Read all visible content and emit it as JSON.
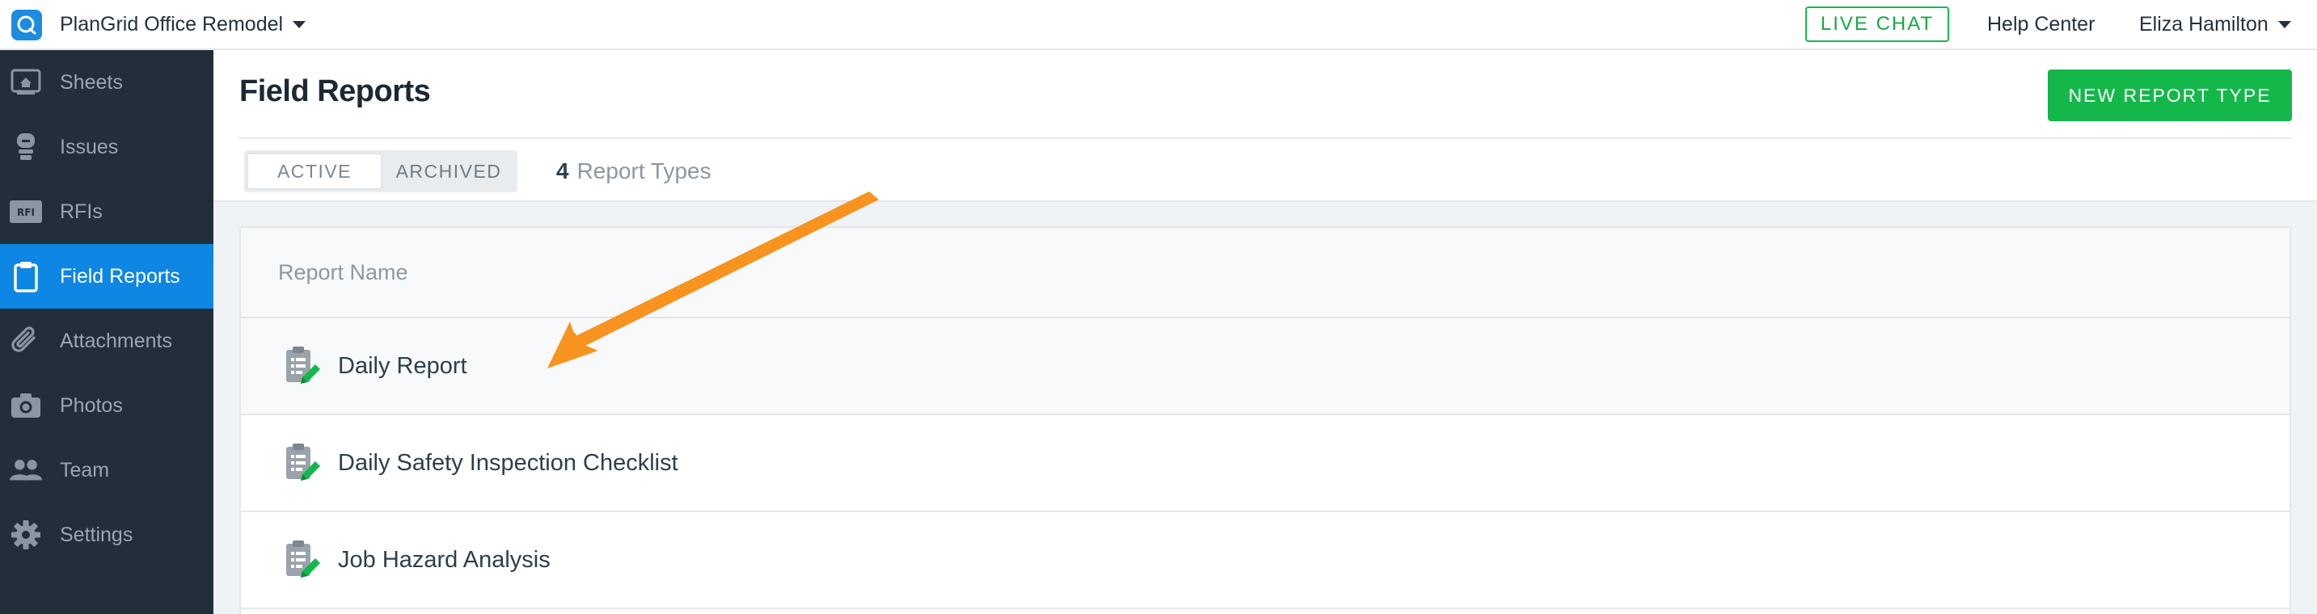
{
  "topbar": {
    "project_name": "PlanGrid Office Remodel",
    "live_chat": "LIVE CHAT",
    "help_center": "Help Center",
    "user_name": "Eliza Hamilton"
  },
  "sidebar": {
    "items": [
      {
        "label": "Sheets",
        "icon": "sheets-icon"
      },
      {
        "label": "Issues",
        "icon": "issues-icon"
      },
      {
        "label": "RFIs",
        "icon": "rfi-icon"
      },
      {
        "label": "Field Reports",
        "icon": "clipboard-icon",
        "active": true
      },
      {
        "label": "Attachments",
        "icon": "paperclip-icon"
      },
      {
        "label": "Photos",
        "icon": "camera-icon"
      },
      {
        "label": "Team",
        "icon": "team-icon"
      },
      {
        "label": "Settings",
        "icon": "gear-icon"
      }
    ]
  },
  "main": {
    "title": "Field Reports",
    "new_report_button": "NEW REPORT TYPE",
    "tabs": [
      {
        "label": "ACTIVE",
        "selected": true
      },
      {
        "label": "ARCHIVED",
        "selected": false
      }
    ],
    "count_number": "4",
    "count_text": "Report Types",
    "table": {
      "header": "Report Name",
      "rows": [
        {
          "name": "Daily Report"
        },
        {
          "name": "Daily Safety Inspection Checklist"
        },
        {
          "name": "Job Hazard Analysis"
        }
      ]
    }
  },
  "colors": {
    "accent_blue": "#0e86e4",
    "accent_green": "#14b84a",
    "sidebar_bg": "#222f3b",
    "annotation_orange": "#f7931e"
  }
}
